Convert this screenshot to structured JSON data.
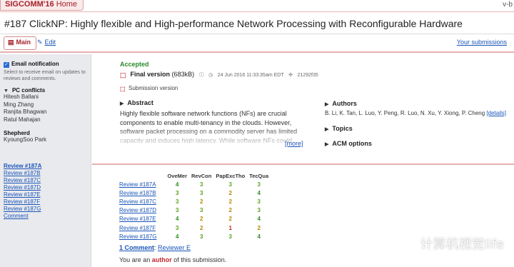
{
  "topbar": {
    "conf": "SIGCOMM'16",
    "home": "Home",
    "right": "v-b"
  },
  "title": "#187   ClickNP: Highly flexible and High-performance Network Processing with Reconfigurable Hardware",
  "tabs": {
    "main": "Main",
    "edit": "Edit",
    "your_submissions": "Your submissions"
  },
  "sidebar": {
    "notify_label": "Email notification",
    "notify_sub": "Select to receive email on updates to reviews and comments.",
    "pc_conflicts_head": "PC conflicts",
    "pc_conflicts": [
      "Hitesh Ballani",
      "Ming Zhang",
      "Ranjita Bhagwan",
      "Ratul Mahajan"
    ],
    "shepherd_head": "Shepherd",
    "shepherd": "KyoungSoo Park",
    "review_links": [
      "Review #187A",
      "Review #187B",
      "Review #187C",
      "Review #187D",
      "Review #187E",
      "Review #187F",
      "Review #187G",
      "Comment"
    ]
  },
  "paper": {
    "status": "Accepted",
    "final_version": "Final version",
    "size": "(683kB)",
    "date": "24 Jun 2016 11:33:35am EDT",
    "hash": "21292f35",
    "submission_version": "Submission version",
    "abstract_head": "Abstract",
    "abstract": "Highly flexible software network functions (NFs) are crucial components to enable multi-tenancy in the clouds. However, software packet processing on a commodity server has limited capacity and induces high latency. While software NFs could",
    "more": "[more]",
    "authors_head": "Authors",
    "authors": "B. Li, K. Tan, L. Luo, Y. Peng, R. Luo, N. Xu, Y. Xiong, P. Cheng",
    "details": "[details]",
    "topics_head": "Topics",
    "acm_head": "ACM options"
  },
  "review_table": {
    "headers": [
      "OveMer",
      "RevCon",
      "PapExcTho",
      "TecQua"
    ],
    "rows": [
      {
        "name": "Review #187A",
        "scores": [
          4,
          3,
          3,
          3
        ]
      },
      {
        "name": "Review #187B",
        "scores": [
          3,
          3,
          2,
          4
        ]
      },
      {
        "name": "Review #187C",
        "scores": [
          3,
          2,
          2,
          3
        ]
      },
      {
        "name": "Review #187D",
        "scores": [
          3,
          3,
          2,
          3
        ]
      },
      {
        "name": "Review #187E",
        "scores": [
          4,
          2,
          2,
          4
        ]
      },
      {
        "name": "Review #187F",
        "scores": [
          3,
          2,
          1,
          2
        ]
      },
      {
        "name": "Review #187G",
        "scores": [
          4,
          3,
          3,
          4
        ]
      }
    ]
  },
  "comment_count": "1 Comment",
  "comment_by": "Reviewer E",
  "author_note": {
    "pre": "You are an ",
    "bold": "author",
    "post": " of this submission."
  },
  "watermark": "计算机视觉life",
  "colors": {
    "accent": "#a5222b",
    "link": "#1a55b8",
    "accepted": "#2b8a2b"
  }
}
